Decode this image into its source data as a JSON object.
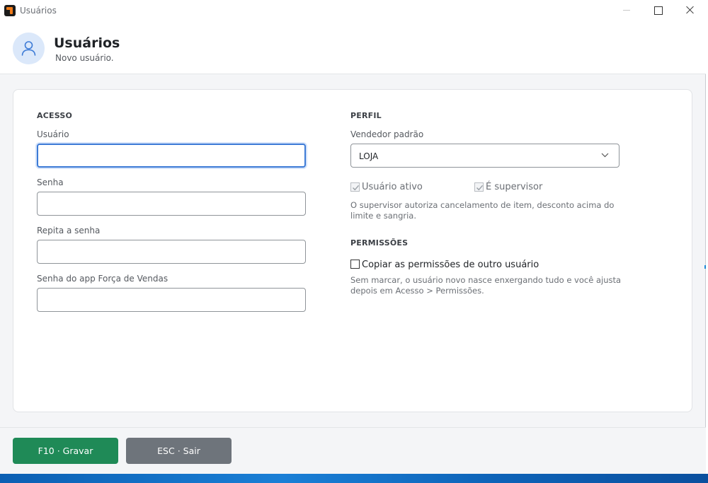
{
  "window": {
    "title": "Usuários"
  },
  "header": {
    "title": "Usuários",
    "subtitle": "Novo usuário.",
    "avatar_icon": "user-icon"
  },
  "acesso": {
    "section_title": "ACESSO",
    "usuario_label": "Usuário",
    "usuario_value": "",
    "senha_label": "Senha",
    "senha_value": "",
    "repita_label": "Repita a senha",
    "repita_value": "",
    "app_senha_label": "Senha do app Força de Vendas",
    "app_senha_value": ""
  },
  "perfil": {
    "section_title": "PERFIL",
    "vendedor_label": "Vendedor padrão",
    "vendedor_value": "LOJA",
    "usuario_ativo_label": "Usuário ativo",
    "usuario_ativo_checked": true,
    "supervisor_label": "É supervisor",
    "supervisor_checked": true,
    "supervisor_hint": "O supervisor autoriza cancelamento de item, desconto acima do limite e sangria."
  },
  "permissoes": {
    "section_title": "PERMISSÕES",
    "copiar_label": "Copiar as permissões de outro usuário",
    "copiar_checked": false,
    "hint": "Sem marcar, o usuário novo nasce enxergando tudo e você ajusta depois em Acesso > Permissões."
  },
  "footer": {
    "save_label": "F10 · Gravar",
    "exit_label": "ESC · Sair"
  },
  "colors": {
    "save_button": "#1f8a57",
    "exit_button": "#6e747b",
    "focus_border": "#3d7bd6",
    "avatar_bg": "#dbe8fa"
  }
}
